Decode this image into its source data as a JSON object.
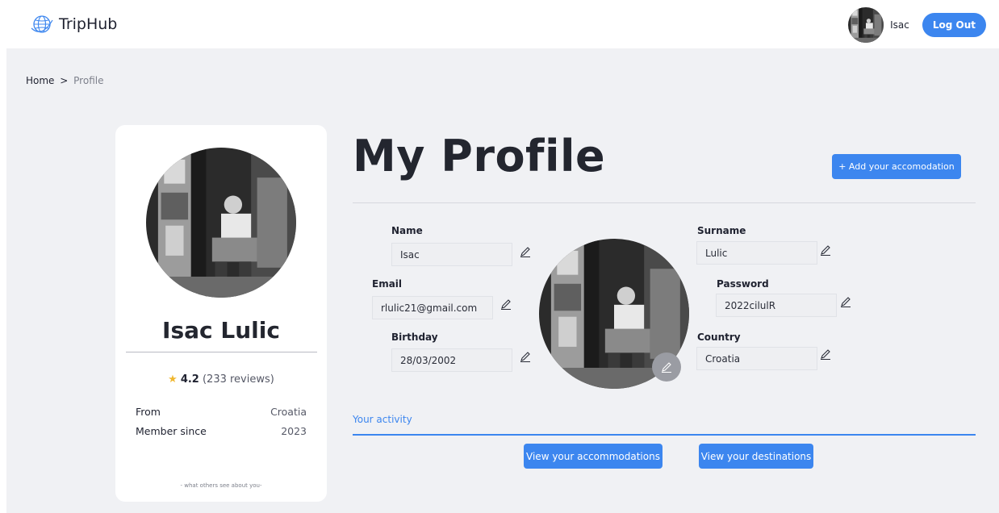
{
  "header": {
    "brand": "TripHub",
    "username": "Isac",
    "logout_label": "Log Out"
  },
  "breadcrumb": {
    "home": "Home",
    "separator": ">",
    "current": "Profile"
  },
  "card": {
    "full_name": "Isac Lulic",
    "rating_score": "4.2",
    "rating_count": "(233 reviews)",
    "from_label": "From",
    "from_value": "Croatia",
    "member_label": "Member since",
    "member_value": "2023",
    "footer": "- what others see about you-"
  },
  "main": {
    "title": "My Profile",
    "add_button": "+ Add your accomodation"
  },
  "form": {
    "name_label": "Name",
    "name_value": "Isac",
    "email_label": "Email",
    "email_value": "rlulic21@gmail.com",
    "birthday_label": "Birthday",
    "birthday_value": "28/03/2002",
    "surname_label": "Surname",
    "surname_value": "Lulic",
    "password_label": "Password",
    "password_value": "2022cilulR",
    "country_label": "Country",
    "country_value": "Croatia"
  },
  "activity": {
    "tab_label": "Your activity",
    "view_accommodations": "View your accommodations",
    "view_destinations": "View your destinations"
  },
  "colors": {
    "accent": "#3c86ef",
    "panel": "#f0f1f4",
    "star": "#f0b72f"
  }
}
